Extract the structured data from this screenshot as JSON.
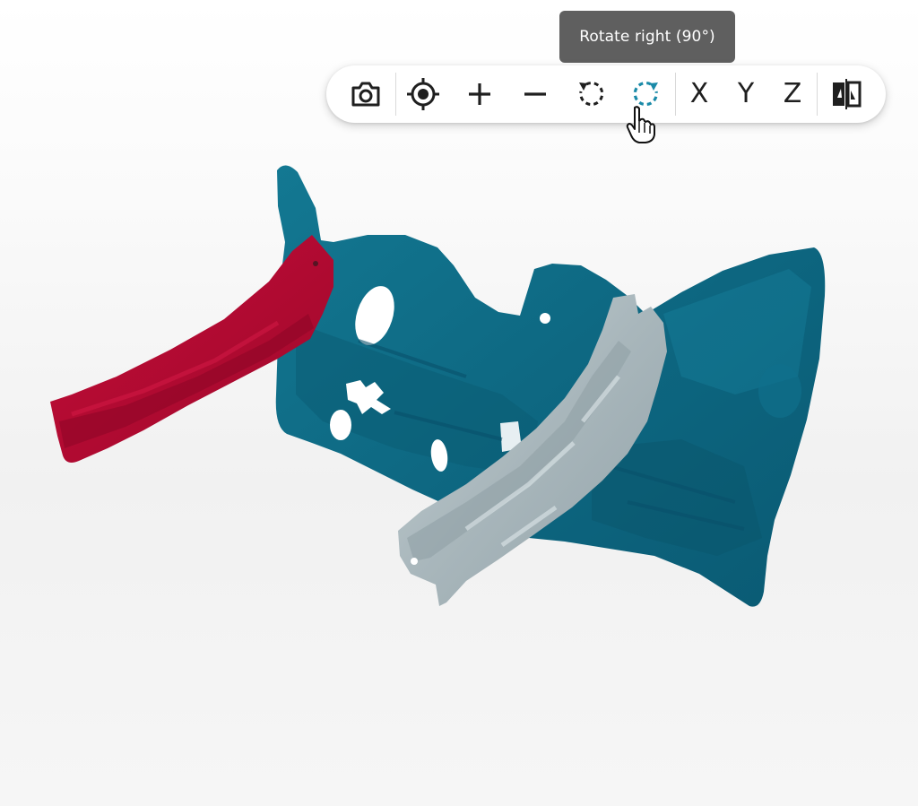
{
  "viewer": {
    "tooltip": "Rotate right (90°)",
    "toolbar": {
      "screenshot_icon": "camera-icon",
      "center_icon": "crosshair-target-icon",
      "zoom_in_icon": "plus-icon",
      "zoom_out_icon": "minus-icon",
      "rotate_left_icon": "rotate-left-icon",
      "rotate_right_icon": "rotate-right-icon",
      "axis_x_label": "X",
      "axis_y_label": "Y",
      "axis_z_label": "Z",
      "compare_icon": "split-compare-icon",
      "active_button": "rotate-right"
    }
  },
  "model": {
    "parts": [
      {
        "name": "main-panel",
        "color": "#0e6a85"
      },
      {
        "name": "red-bracket",
        "color": "#b20a32"
      },
      {
        "name": "grey-rail",
        "color": "#a9b7bd"
      }
    ]
  },
  "colors": {
    "accent": "#1a8aa8",
    "toolbar_bg": "#ffffff",
    "tooltip_bg": "#5f5f5f",
    "background": "#f3f3f3"
  }
}
